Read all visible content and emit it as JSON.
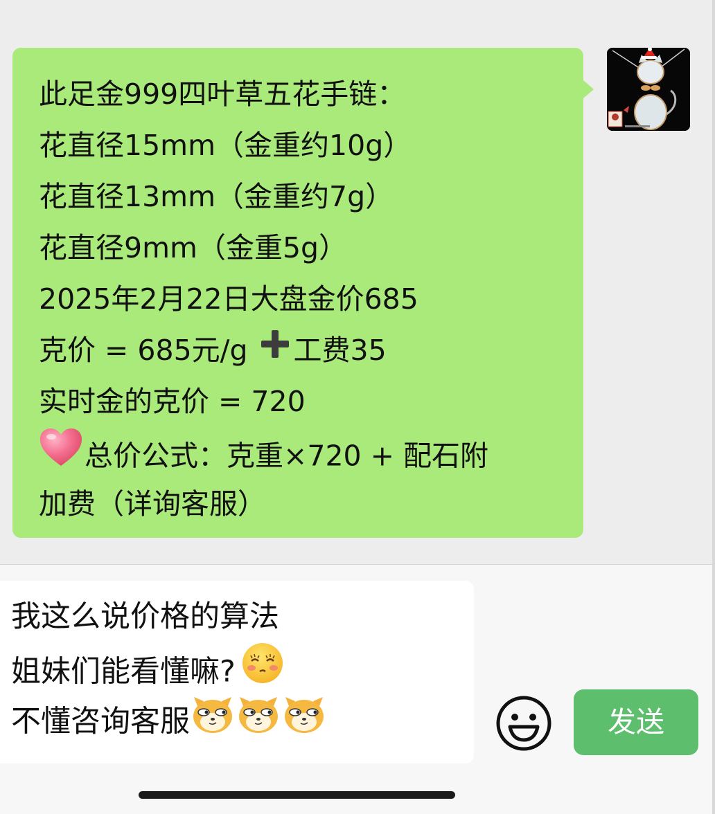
{
  "chat": {
    "message_lines": [
      "此足金999四叶草五花手链：",
      "花直径15mm（金重约10g）",
      "花直径13mm（金重约7g）",
      "花直径9mm（金重5g）",
      "2025年2月22日大盘金价685",
      "克价 = 685元/g",
      "工费35",
      "实时金的克价 = 720",
      "总价公式：克重×720 + 配石附",
      "加费（详询客服）"
    ],
    "plus_emoji": "heavy-plus-icon",
    "heart_emoji": "heart-icon",
    "avatar": "cat-jade-pendant-avatar"
  },
  "composer": {
    "lines": [
      "我这么说价格的算法",
      "姐妹们能看懂嘛?",
      "不懂咨询客服"
    ],
    "shy_emoji": "shy-face-emoji-icon",
    "doge_emoji": "doge-cat-emoji-icon",
    "emoji_button_icon": "smiley-icon",
    "send_label": "发送"
  },
  "colors": {
    "background": "#ededed",
    "bubble_green": "#a9ea7a",
    "send_button": "#5dbf6e",
    "input_bg": "#ffffff"
  }
}
